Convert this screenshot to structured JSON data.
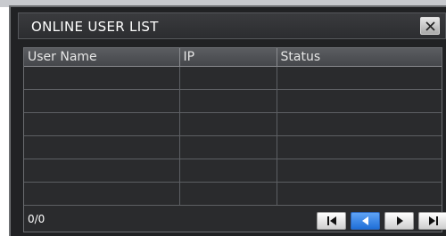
{
  "window": {
    "title": "ONLINE USER LIST",
    "close_icon": "close-icon"
  },
  "table": {
    "columns": [
      "User Name",
      "IP",
      "Status"
    ],
    "rows": [
      [
        "",
        "",
        ""
      ],
      [
        "",
        "",
        ""
      ],
      [
        "",
        "",
        ""
      ],
      [
        "",
        "",
        ""
      ],
      [
        "",
        "",
        ""
      ],
      [
        "",
        "",
        ""
      ]
    ]
  },
  "footer": {
    "page_count": "0/0",
    "nav_buttons": [
      {
        "icon": "first-page-icon",
        "active": false
      },
      {
        "icon": "previous-page-icon",
        "active": true
      },
      {
        "icon": "next-page-icon",
        "active": false
      },
      {
        "icon": "last-page-icon",
        "active": false
      }
    ]
  },
  "colors": {
    "window_bg": "#212224",
    "header_bg": "#4e5054",
    "active_button": "#2f80e6"
  }
}
